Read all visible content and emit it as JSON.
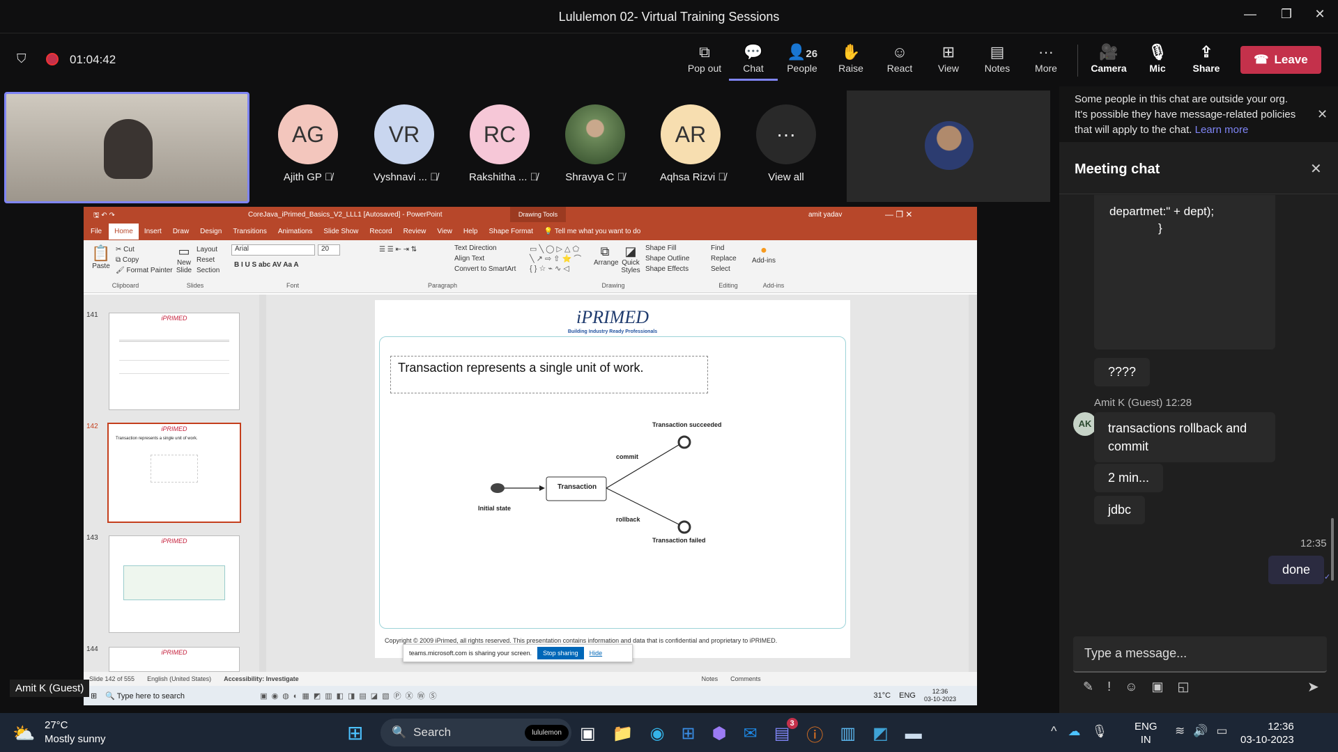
{
  "window": {
    "title": "Lululemon 02- Virtual Training Sessions"
  },
  "meeting": {
    "timer": "01:04:42",
    "toolbar": [
      {
        "label": "Pop out",
        "icon": "popout-icon"
      },
      {
        "label": "Chat",
        "icon": "chat-icon"
      },
      {
        "label": "People",
        "icon": "people-icon",
        "count": "26"
      },
      {
        "label": "Raise",
        "icon": "hand-icon"
      },
      {
        "label": "React",
        "icon": "smile-icon"
      },
      {
        "label": "View",
        "icon": "grid-icon"
      },
      {
        "label": "Notes",
        "icon": "notes-icon"
      },
      {
        "label": "More",
        "icon": "more-icon"
      },
      {
        "label": "Camera",
        "icon": "camera-off-icon"
      },
      {
        "label": "Mic",
        "icon": "mic-off-icon"
      },
      {
        "label": "Share",
        "icon": "share-icon"
      }
    ],
    "leave_label": "Leave",
    "participants": [
      {
        "initials": "AG",
        "name": "Ajith GP",
        "color": "#f3c6bd"
      },
      {
        "initials": "VR",
        "name": "Vyshnavi ...",
        "color": "#c9d6ef"
      },
      {
        "initials": "RC",
        "name": "Rakshitha ...",
        "color": "#f6c7d7"
      },
      {
        "initials": "",
        "name": "Shravya C",
        "color": "#6d8a5a"
      },
      {
        "initials": "AR",
        "name": "Aqhsa Rizvi",
        "color": "#f7deb0"
      },
      {
        "initials": "",
        "name": "View all",
        "color": "#292929"
      }
    ],
    "presenter_label": "Amit K (Guest)"
  },
  "ppt": {
    "title": "CoreJava_iPrimed_Basics_V2_LLL1 [Autosaved] - PowerPoint",
    "drawing_tools": "Drawing Tools",
    "user": "amit yadav",
    "tabs": [
      "File",
      "Home",
      "Insert",
      "Draw",
      "Design",
      "Transitions",
      "Animations",
      "Slide Show",
      "Record",
      "Review",
      "View",
      "Help",
      "Shape Format"
    ],
    "tell_me": "Tell me what you want to do",
    "clipboard": [
      "Cut",
      "Copy",
      "Format Painter"
    ],
    "paste": "Paste",
    "slides_group": [
      "Layout",
      "Reset",
      "Section"
    ],
    "new_slide": "New Slide",
    "font": "Arial",
    "font_size": "20",
    "paragraph": [
      "Text Direction",
      "Align Text",
      "Convert to SmartArt"
    ],
    "drawing": [
      "Shape Fill",
      "Shape Outline",
      "Shape Effects"
    ],
    "arrange": "Arrange",
    "quick_styles": "Quick Styles",
    "editing": [
      "Find",
      "Replace",
      "Select"
    ],
    "addins": "Add-ins",
    "groups": [
      "Clipboard",
      "Slides",
      "Font",
      "Paragraph",
      "Drawing",
      "Editing",
      "Add-ins"
    ],
    "thumbs": [
      "141",
      "142",
      "143",
      "144"
    ],
    "slide": {
      "logo": "iPRIMED",
      "tagline": "Building Industry Ready Professionals",
      "text": "Transaction represents a single unit of work.",
      "diagram": {
        "initial": "Initial state",
        "transaction": "Transaction",
        "commit": "commit",
        "rollback": "rollback",
        "succeeded": "Transaction succeeded",
        "failed": "Transaction failed"
      },
      "footer": "Copyright © 2009 iPrimed, all rights reserved. This presentation contains information  and data  that is confidential and proprietary to iPRIMED."
    },
    "status": {
      "slide": "Slide 142 of 555",
      "lang": "English (United States)",
      "access": "Accessibility: Investigate",
      "notes": "Notes",
      "comments": "Comments"
    },
    "sharing_bar": {
      "text": "teams.microsoft.com is sharing your screen.",
      "stop": "Stop sharing",
      "hide": "Hide"
    },
    "inner_taskbar": {
      "search": "Type here to search",
      "temp": "31°C",
      "lang": "ENG",
      "time": "12:36",
      "date": "03-10-2023"
    }
  },
  "chat": {
    "notice": "Some people in this chat are outside your org. It's possible they have message-related policies that will apply to the chat.",
    "notice_link": "Learn more",
    "title": "Meeting chat",
    "code_line1": "departmet:\" + dept);",
    "code_line2": "}",
    "msg_q": "????",
    "sender": "Amit K (Guest)",
    "sender_time": "12:28",
    "sender_initials": "AK",
    "msg1": "transactions rollback and commit",
    "msg2": "2 min...",
    "msg3": "jdbc",
    "my_time": "12:35",
    "my_msg": "done",
    "input_placeholder": "Type a message..."
  },
  "taskbar": {
    "weather_temp": "27°C",
    "weather_desc": "Mostly sunny",
    "search": "Search",
    "search_badge": "lululemon",
    "teams_badge": "3",
    "lang1": "ENG",
    "lang2": "IN",
    "time": "12:36",
    "date": "03-10-2023"
  }
}
